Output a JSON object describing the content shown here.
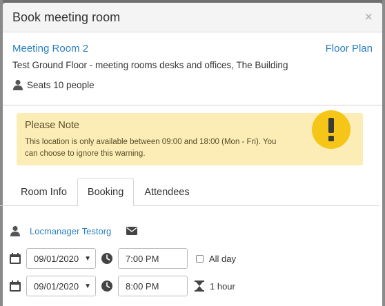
{
  "dialog": {
    "title": "Book meeting room",
    "close_label": "×"
  },
  "room": {
    "name": "Meeting Room 2",
    "floor_plan_label": "Floor Plan",
    "location": "Test Ground Floor - meeting rooms desks and offices, The Building",
    "seats": "Seats 10 people"
  },
  "alert": {
    "title": "Please Note",
    "body": "This location is only available between 09:00 and 18:00 (Mon - Fri). You can choose to ignore this warning.",
    "icon": "exclamation-icon",
    "color": "#f5c518",
    "background": "#fcedb7"
  },
  "tabs": [
    {
      "label": "Room Info",
      "active": false
    },
    {
      "label": "Booking",
      "active": true
    },
    {
      "label": "Attendees",
      "active": false
    }
  ],
  "booking": {
    "organiser": "Locmanager Testorg",
    "start_date": "09/01/2020",
    "start_time": "7:00 PM",
    "all_day_label": "All day",
    "all_day_checked": false,
    "end_date": "09/01/2020",
    "end_time": "8:00 PM",
    "duration": "1 hour"
  },
  "colors": {
    "link": "#2a7fc1"
  }
}
